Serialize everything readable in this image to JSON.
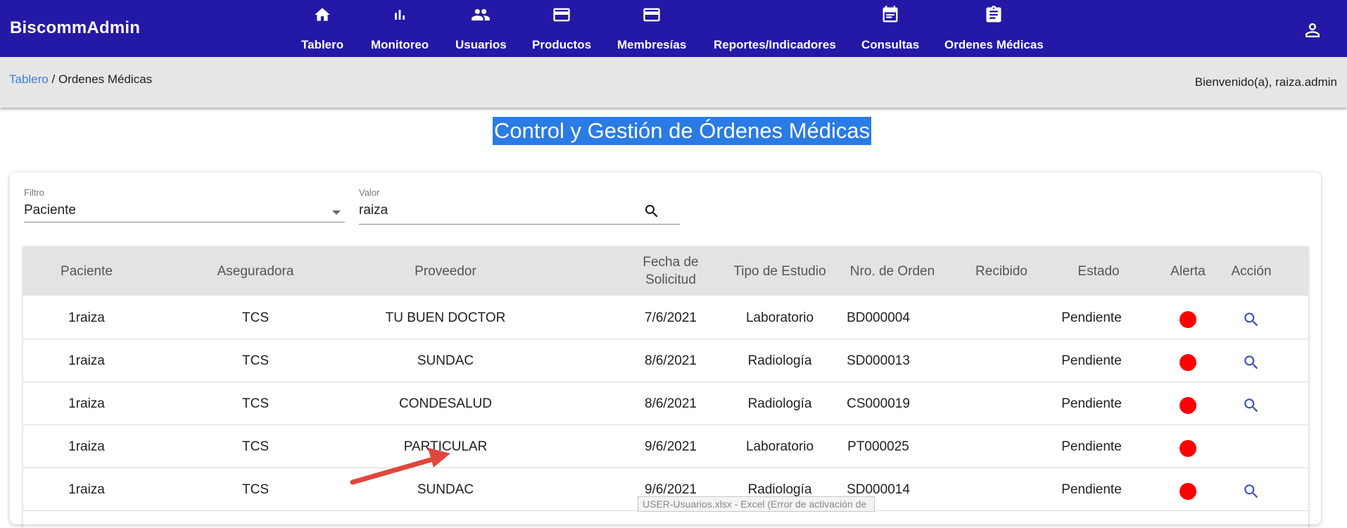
{
  "app": {
    "brand": "BiscommAdmin"
  },
  "nav": {
    "items": [
      {
        "label": "Tablero",
        "icon": "home-icon"
      },
      {
        "label": "Monitoreo",
        "icon": "bar-chart-icon"
      },
      {
        "label": "Usuarios",
        "icon": "people-icon"
      },
      {
        "label": "Productos",
        "icon": "card-icon"
      },
      {
        "label": "Membresías",
        "icon": "card-icon"
      },
      {
        "label": "Reportes/Indicadores",
        "icon": ""
      },
      {
        "label": "Consultas",
        "icon": "calendar-icon"
      },
      {
        "label": "Ordenes Médicas",
        "icon": "clipboard-icon"
      }
    ],
    "account_icon": "account-icon"
  },
  "breadcrumb": {
    "home": "Tablero",
    "separator": " / ",
    "current": "Ordenes Médicas"
  },
  "welcome": "Bienvenido(a), raiza.admin",
  "page_title": "Control y Gestión de Órdenes Médicas",
  "filters": {
    "filtro_label": "Filtro",
    "filtro_value": "Paciente",
    "valor_label": "Valor",
    "valor_value": "raiza"
  },
  "table": {
    "headers": {
      "paciente": "Paciente",
      "aseguradora": "Aseguradora",
      "proveedor": "Proveedor",
      "fecha_l1": "Fecha de",
      "fecha_l2": "Solicitud",
      "tipo": "Tipo de Estudio",
      "orden": "Nro. de Orden",
      "recibido": "Recibido",
      "estado": "Estado",
      "alerta": "Alerta",
      "accion": "Acción"
    },
    "rows": [
      {
        "paciente": "1raiza",
        "aseguradora": "TCS",
        "proveedor": "TU BUEN DOCTOR",
        "fecha": "7/6/2021",
        "tipo": "Laboratorio",
        "orden": "BD000004",
        "recibido": "",
        "estado": "Pendiente",
        "alert_color": "#ff0000",
        "has_action": true
      },
      {
        "paciente": "1raiza",
        "aseguradora": "TCS",
        "proveedor": "SUNDAC",
        "fecha": "8/6/2021",
        "tipo": "Radiología",
        "orden": "SD000013",
        "recibido": "",
        "estado": "Pendiente",
        "alert_color": "#ff0000",
        "has_action": true
      },
      {
        "paciente": "1raiza",
        "aseguradora": "TCS",
        "proveedor": "CONDESALUD",
        "fecha": "8/6/2021",
        "tipo": "Radiología",
        "orden": "CS000019",
        "recibido": "",
        "estado": "Pendiente",
        "alert_color": "#ff0000",
        "has_action": true
      },
      {
        "paciente": "1raiza",
        "aseguradora": "TCS",
        "proveedor": "PARTICULAR",
        "fecha": "9/6/2021",
        "tipo": "Laboratorio",
        "orden": "PT000025",
        "recibido": "",
        "estado": "Pendiente",
        "alert_color": "#ff0000",
        "has_action": false
      },
      {
        "paciente": "1raiza",
        "aseguradora": "TCS",
        "proveedor": "SUNDAC",
        "fecha": "9/6/2021",
        "tipo": "Radiología",
        "orden": "SD000014",
        "recibido": "",
        "estado": "Pendiente",
        "alert_color": "#ff0000",
        "has_action": true
      }
    ]
  },
  "taskbar_tooltip": "USER-Usuarios.xlsx - Excel (Error de activación de",
  "colors": {
    "appbar": "#2418a6",
    "title_highlight": "#2a7be4",
    "arrow": "#e0473c",
    "link": "#3b7fd8"
  }
}
